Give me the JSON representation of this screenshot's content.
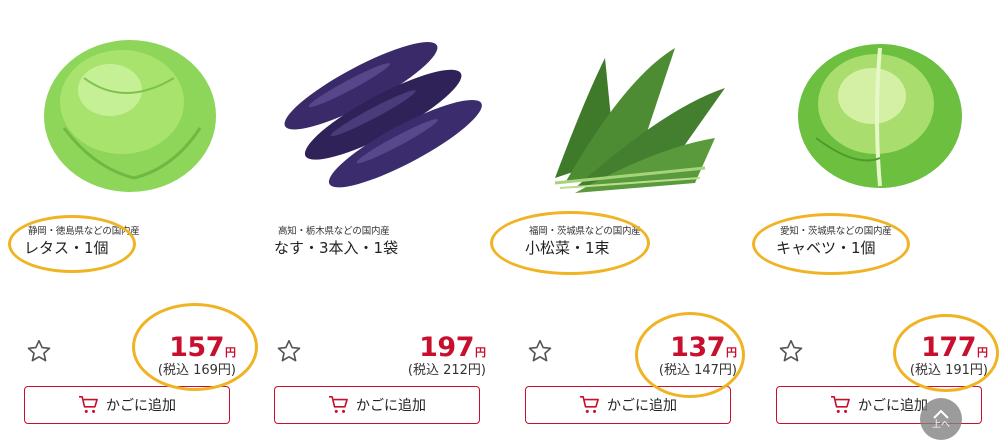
{
  "products": [
    {
      "origin": "静岡・徳島県などの国内産",
      "name": "レタス・1個",
      "price": "157",
      "yen": "円",
      "tax_price": "(税込 169円)",
      "cart_label": "かごに追加"
    },
    {
      "origin": "高知・栃木県などの国内産",
      "name": "なす・3本入・1袋",
      "price": "197",
      "yen": "円",
      "tax_price": "(税込 212円)",
      "cart_label": "かごに追加"
    },
    {
      "origin": "福岡・茨城県などの国内産",
      "name": "小松菜・1束",
      "price": "137",
      "yen": "円",
      "tax_price": "(税込 147円)",
      "cart_label": "かごに追加"
    },
    {
      "origin": "愛知・茨城県などの国内産",
      "name": "キャベツ・1個",
      "price": "177",
      "yen": "円",
      "tax_price": "(税込 191円)",
      "cart_label": "かごに追加"
    }
  ],
  "scroll_top": {
    "label": "上へ"
  },
  "colors": {
    "price_red": "#c8102e",
    "highlight": "#f0b323",
    "icon_bg": "#808080"
  }
}
